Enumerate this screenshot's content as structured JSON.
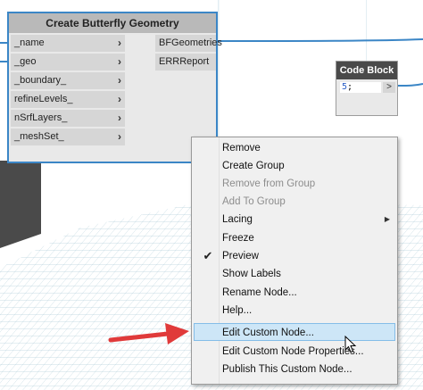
{
  "node": {
    "title": "Create Butterfly Geometry",
    "inputs": [
      "_name",
      "_geo",
      "_boundary_",
      "refineLevels_",
      "nSrfLayers_",
      "_meshSet_"
    ],
    "outputs": [
      "BFGeometries",
      "ERRReport"
    ]
  },
  "code_block": {
    "title": "Code Block",
    "value": "5",
    "suffix": ";",
    "out_arrow": ">"
  },
  "context_menu": {
    "items": [
      {
        "label": "Remove",
        "enabled": true
      },
      {
        "label": "Create Group",
        "enabled": true
      },
      {
        "label": "Remove from Group",
        "enabled": false
      },
      {
        "label": "Add To Group",
        "enabled": false
      },
      {
        "label": "Lacing",
        "enabled": true,
        "submenu": true
      },
      {
        "label": "Freeze",
        "enabled": true
      },
      {
        "label": "Preview",
        "enabled": true,
        "checked": true
      },
      {
        "label": "Show Labels",
        "enabled": true
      },
      {
        "label": "Rename Node...",
        "enabled": true
      },
      {
        "label": "Help...",
        "enabled": true
      },
      {
        "label": "Edit Custom Node...",
        "enabled": true,
        "highlighted": true
      },
      {
        "label": "Edit Custom Node Properties...",
        "enabled": true
      },
      {
        "label": "Publish This Custom Node...",
        "enabled": true
      }
    ]
  },
  "colors": {
    "wire": "#3b86c6",
    "annotation_arrow": "#e03a3a",
    "highlight": "#cde6f7"
  },
  "icons": {
    "check": "check-icon",
    "submenu": "submenu-arrow-icon",
    "cursor": "mouse-cursor-icon"
  }
}
